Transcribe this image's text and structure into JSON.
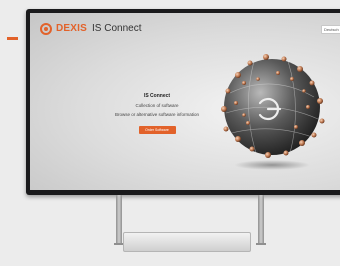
{
  "header": {
    "brand": "DEXIS",
    "product": "IS Connect",
    "language_select": "Deutsch"
  },
  "hero": {
    "title": "IS Connect",
    "line1": "Collection of software",
    "line2": "Browse or alternative software information",
    "cta_label": "Order Software"
  },
  "colors": {
    "accent": "#e2622a",
    "monitor_bezel": "#1a1a1c",
    "page_background": "#ececec"
  },
  "icons": {
    "logo": "dexis-logo-icon",
    "hero_image": "molecular-sphere-icon"
  }
}
